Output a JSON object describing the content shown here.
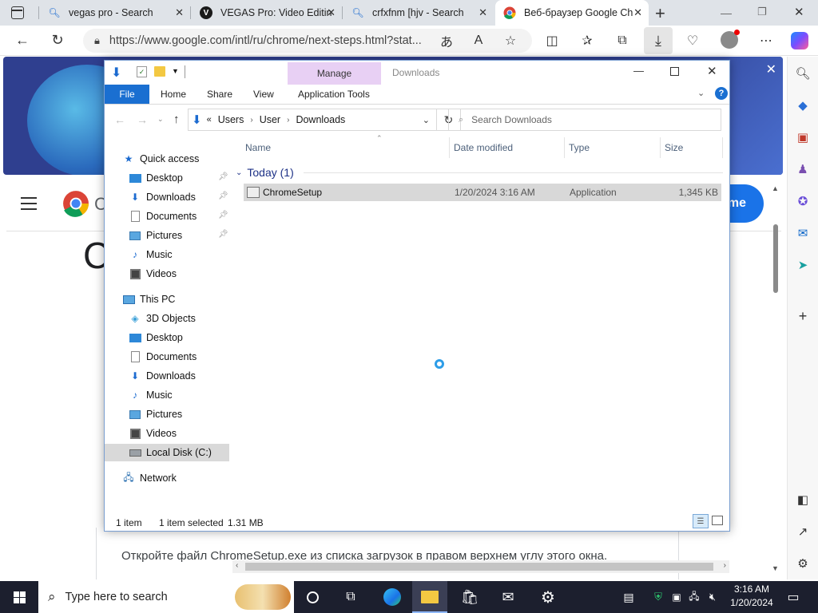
{
  "browser": {
    "tabs": [
      {
        "title": "vegas pro - Search",
        "icon": "search-icon"
      },
      {
        "title": "VEGAS Pro: Video Editin",
        "icon": "vegas-icon"
      },
      {
        "title": "crfxfnm [hjv - Search",
        "icon": "search-icon"
      },
      {
        "title": "Веб-браузер Google Ch",
        "icon": "chrome-icon"
      }
    ],
    "new_tab": "+",
    "url": "https://www.google.com/intl/ru/chrome/next-steps.html?stat..."
  },
  "page": {
    "instruction": "Откройте файл ChromeSetup.exe из списка загрузок в правом верхнем углу этого окна.",
    "logo_letter": "C",
    "heading_letter": "C",
    "button_text": "me"
  },
  "explorer": {
    "title": "Downloads",
    "context_tab": "Manage",
    "ribbon_tabs": [
      "File",
      "Home",
      "Share",
      "View",
      "Application Tools"
    ],
    "breadcrumb": [
      "Users",
      "User",
      "Downloads"
    ],
    "search_placeholder": "Search Downloads",
    "columns": {
      "name": "Name",
      "date": "Date modified",
      "type": "Type",
      "size": "Size"
    },
    "group": "Today (1)",
    "files": [
      {
        "name": "ChromeSetup",
        "date": "1/20/2024 3:16 AM",
        "type": "Application",
        "size": "1,345 KB"
      }
    ],
    "nav": {
      "quick_access": "Quick access",
      "quick_items": [
        "Desktop",
        "Downloads",
        "Documents",
        "Pictures",
        "Music",
        "Videos"
      ],
      "this_pc": "This PC",
      "pc_items": [
        "3D Objects",
        "Desktop",
        "Documents",
        "Downloads",
        "Music",
        "Pictures",
        "Videos",
        "Local Disk (C:)"
      ],
      "network": "Network"
    },
    "status": {
      "count": "1 item",
      "selected": "1 item selected",
      "size": "1.31 MB"
    }
  },
  "taskbar": {
    "search_placeholder": "Type here to search",
    "time": "3:16 AM",
    "date": "1/20/2024"
  }
}
